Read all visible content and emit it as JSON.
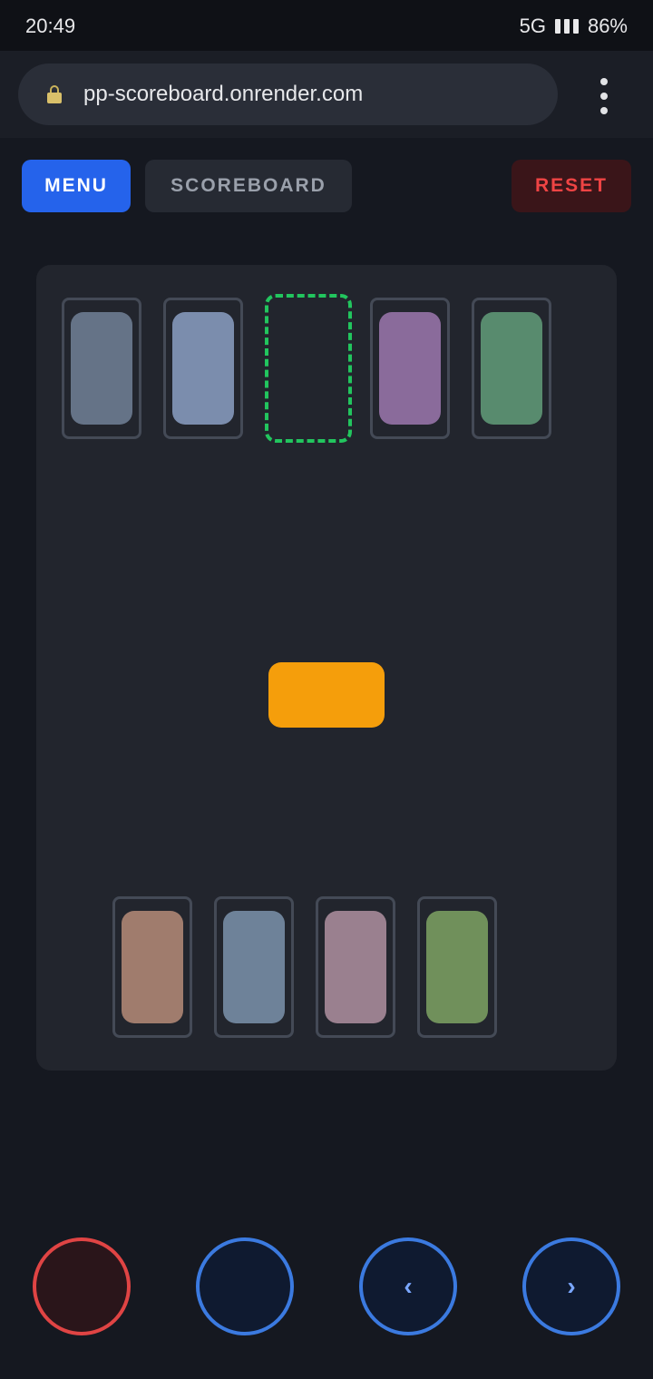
{
  "status": {
    "time": "20:49",
    "network": "5G",
    "battery": "86%"
  },
  "browser": {
    "url": "pp-scoreboard.onrender.com"
  },
  "toolbar": {
    "menu_label": "MENU",
    "scoreboard_label": "SCOREBOARD",
    "reset_label": "RESET"
  },
  "board": {
    "top_slots": [
      {
        "color": "#657387"
      },
      {
        "color": "#7b8dad"
      },
      {
        "color": null,
        "target": true
      },
      {
        "color": "#8a6b9b"
      },
      {
        "color": "#588b6e"
      }
    ],
    "center_color": "#f59e0b",
    "bottom_slots": [
      {
        "color": "#a07c6d"
      },
      {
        "color": "#6e8299"
      },
      {
        "color": "#9a808f"
      },
      {
        "color": "#70905b"
      }
    ]
  },
  "controls": [
    {
      "name": "red-action-button",
      "glyph": "",
      "border": "#e04444",
      "fill": "#2a151a"
    },
    {
      "name": "blue-action-button",
      "glyph": "",
      "border": "#3b7ae0",
      "fill": "#0f1a30"
    },
    {
      "name": "prev-button",
      "glyph": "‹",
      "border": "#3b7ae0",
      "fill": "#0f1a30"
    },
    {
      "name": "next-button",
      "glyph": "›",
      "border": "#3b7ae0",
      "fill": "#0f1a30"
    }
  ]
}
